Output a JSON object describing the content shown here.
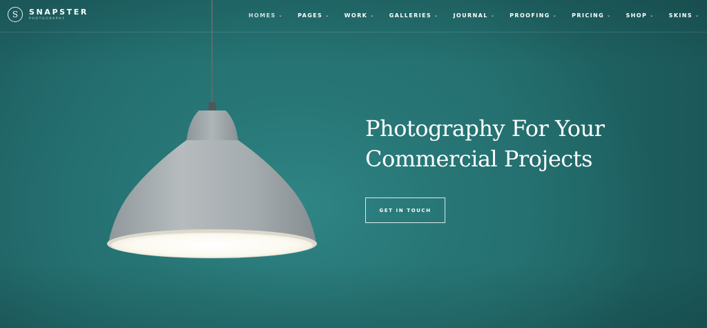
{
  "brand": {
    "name": "SNAPSTER",
    "tagline": "PHOTOGRAPHY",
    "mark_letter": "S"
  },
  "nav": {
    "items": [
      {
        "label": "HOMES",
        "active": true
      },
      {
        "label": "PAGES"
      },
      {
        "label": "WORK"
      },
      {
        "label": "GALLERIES"
      },
      {
        "label": "JOURNAL"
      },
      {
        "label": "PROOFING"
      },
      {
        "label": "PRICING"
      },
      {
        "label": "SHOP"
      },
      {
        "label": "SKINS"
      }
    ],
    "dropdown_glyph": "⌄"
  },
  "hero": {
    "headline_line1": "Photography For Your",
    "headline_line2": "Commercial Projects",
    "cta_label": "GET IN TOUCH"
  },
  "colors": {
    "background": "#236c6c",
    "text": "#ffffff",
    "lamp_shade": "#a9b0b3",
    "lamp_light": "#fbfaf2"
  },
  "icons": [
    "logo-mark-icon",
    "chevron-down-icon",
    "pendant-lamp-icon"
  ]
}
